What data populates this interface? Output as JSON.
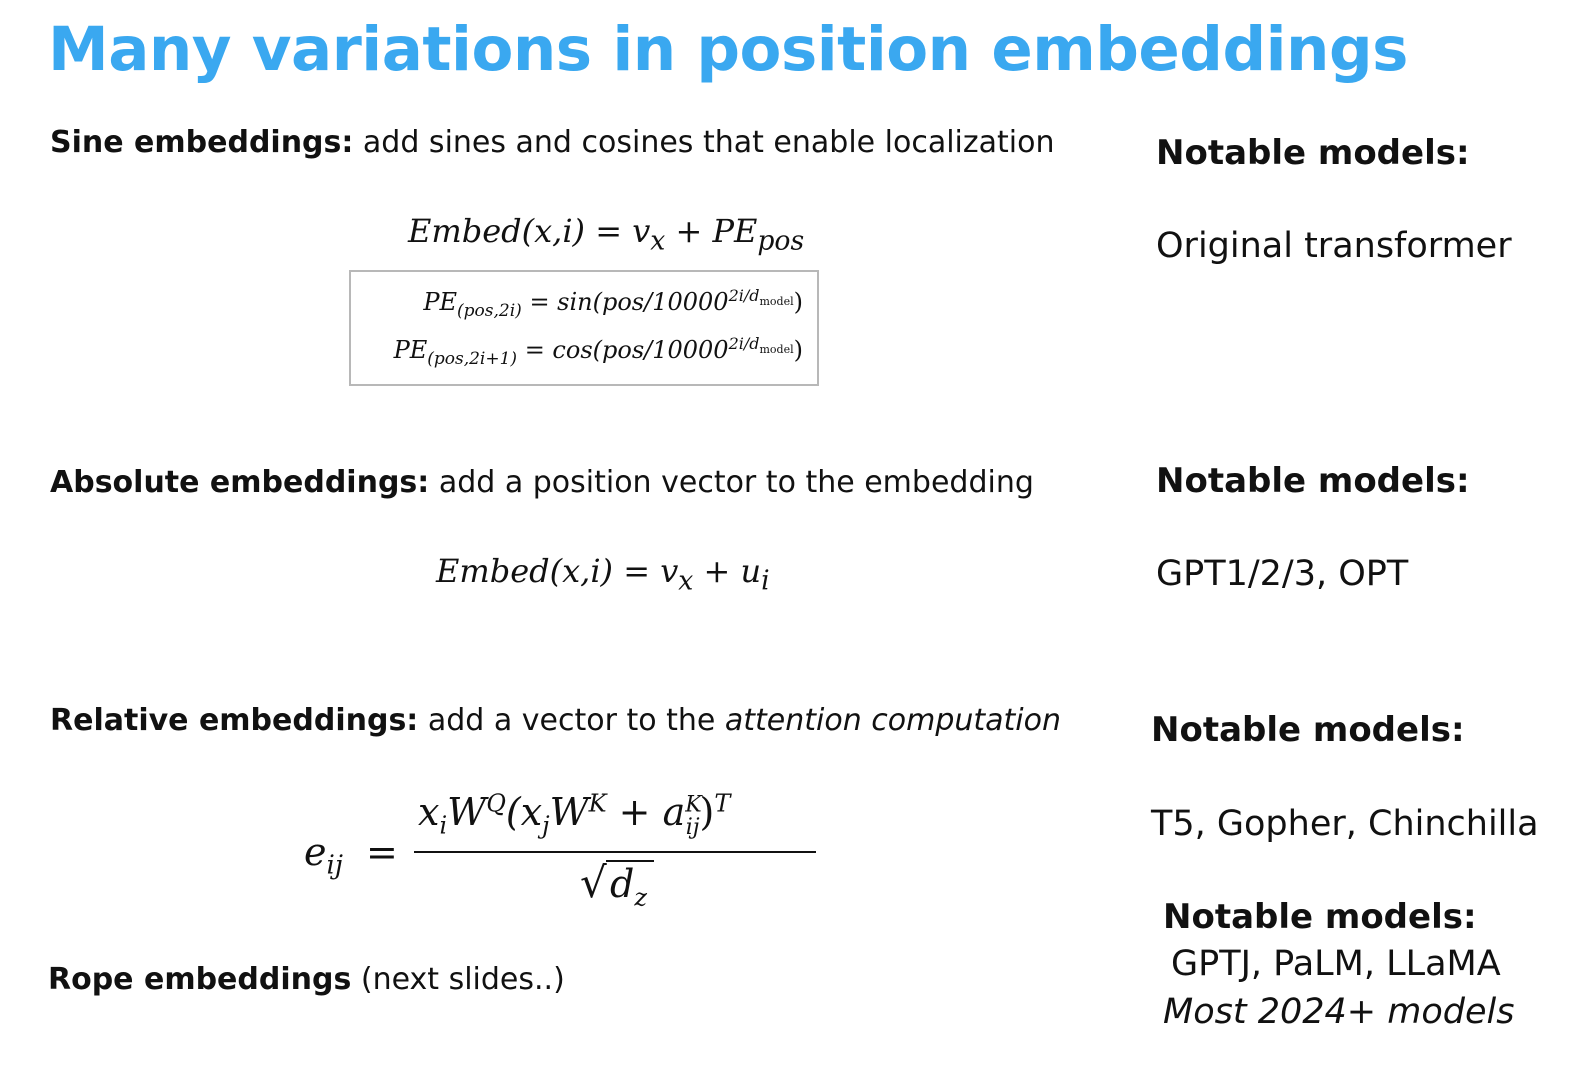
{
  "title": "Many variations in position embeddings",
  "sections": {
    "sine": {
      "label": "Sine embeddings:",
      "desc": " add sines and cosines that enable localization",
      "formula": {
        "lhs": "Embed(x,i)",
        "eq": " = ",
        "v": "v",
        "v_sub": "x",
        "plus": " + ",
        "pe": "PE",
        "pe_sub": "pos"
      },
      "pe_box": {
        "line1": {
          "lhs": "PE",
          "sub": "(pos,2i)",
          "rhs": " = sin(pos/10000",
          "sup": "2i/d",
          "sup_sub": "model",
          "close": ")"
        },
        "line2": {
          "lhs": "PE",
          "sub": "(pos,2i+1)",
          "rhs": " = cos(pos/10000",
          "sup": "2i/d",
          "sup_sub": "model",
          "close": ")"
        }
      },
      "notable_heading": "Notable models:",
      "notable_models": "Original transformer"
    },
    "absolute": {
      "label": "Absolute embeddings:",
      "desc": " add a position vector to the embedding",
      "formula": {
        "lhs": "Embed(x,i)",
        "eq": " = ",
        "v": "v",
        "v_sub": "x",
        "plus": " + ",
        "u": "u",
        "u_sub": "i"
      },
      "notable_heading": "Notable models:",
      "notable_models": "GPT1/2/3, OPT"
    },
    "relative": {
      "label": "Relative embeddings:",
      "desc_pre": " add a vector to the ",
      "desc_italic": "attention computation",
      "formula": {
        "lhs": "e",
        "lhs_sub": "ij",
        "eq": "=",
        "num": {
          "x": "x",
          "x_sub": "i",
          "W": "W",
          "W_sup": "Q",
          "open": "(x",
          "xj_sub": "j",
          "W2": "W",
          "W2_sup": "K",
          "plus": " + a",
          "a_sup": "K",
          "a_sub": "ij",
          "close": ")",
          "T": "T"
        },
        "sqrt": "√",
        "den": "d",
        "den_sub": "z"
      },
      "notable_heading": "Notable models:",
      "notable_models": "T5, Gopher, Chinchilla"
    },
    "rope": {
      "label": "Rope embeddings",
      "desc": " (next slides..)",
      "notable_heading": "Notable models:",
      "notable_models": "GPTJ, PaLM, LLaMA",
      "notable_note": "Most 2024+ models"
    }
  },
  "colors": {
    "title": "#3aa8f0",
    "text": "#111111",
    "box_border": "#b8b8b8"
  }
}
